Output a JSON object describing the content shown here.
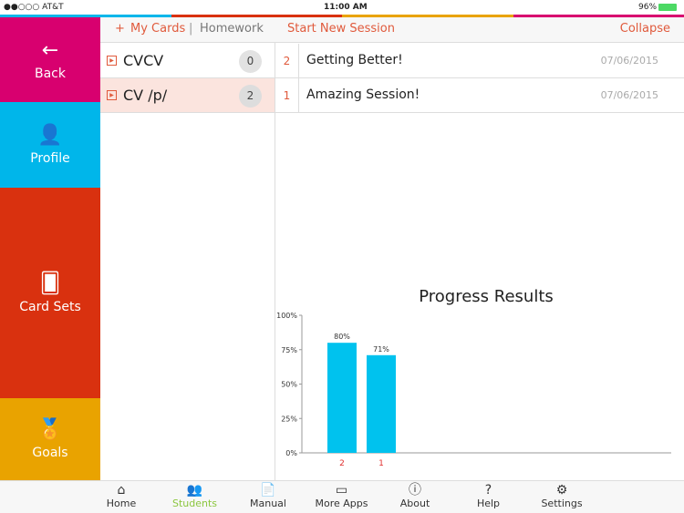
{
  "status": {
    "carrier": "●●○○○ AT&T",
    "time": "11:00 AM",
    "battery": "96%"
  },
  "colors": {
    "magenta": "#d8006f",
    "cyan": "#00b6ea",
    "red": "#d9310f",
    "yellow": "#e9a300",
    "accent": "#e05a3c",
    "bar": "#00c2ee",
    "tab_active": "#8cc63f"
  },
  "sidebar": [
    {
      "label": "Back",
      "icon": "arrow-left-icon",
      "glyph": "←"
    },
    {
      "label": "Profile",
      "icon": "person-icon",
      "glyph": "👤"
    },
    {
      "label": "Card Sets",
      "icon": "cards-icon",
      "glyph": "🂠"
    },
    {
      "label": "Goals",
      "icon": "award-icon",
      "glyph": "🏅"
    }
  ],
  "topbar": {
    "add": "+",
    "my_cards": "My Cards",
    "sep": "|",
    "homework": "Homework",
    "start": "Start New Session",
    "collapse": "Collapse"
  },
  "cards": [
    {
      "name": "CVCV",
      "count": "0"
    },
    {
      "name": "CV /p/",
      "count": "2"
    }
  ],
  "sessions": [
    {
      "num": "2",
      "title": "Getting Better!",
      "date": "07/06/2015"
    },
    {
      "num": "1",
      "title": "Amazing Session!",
      "date": "07/06/2015"
    }
  ],
  "chart_data": {
    "type": "bar",
    "title": "Progress Results",
    "categories": [
      "2",
      "1"
    ],
    "values": [
      80,
      71
    ],
    "labels": [
      "80%",
      "71%"
    ],
    "yticks": [
      "0%",
      "25%",
      "50%",
      "75%",
      "100%"
    ],
    "ylim": [
      0,
      100
    ],
    "grid": false
  },
  "tabs": [
    {
      "label": "Home",
      "glyph": "⌂",
      "icon": "home-icon"
    },
    {
      "label": "Students",
      "glyph": "👥",
      "icon": "students-icon"
    },
    {
      "label": "Manual",
      "glyph": "📄",
      "icon": "document-icon"
    },
    {
      "label": "More Apps",
      "glyph": "▭",
      "icon": "tablet-icon"
    },
    {
      "label": "About",
      "glyph": "ⓘ",
      "icon": "info-icon"
    },
    {
      "label": "Help",
      "glyph": "?",
      "icon": "help-icon"
    },
    {
      "label": "Settings",
      "glyph": "⚙",
      "icon": "gear-icon"
    }
  ]
}
